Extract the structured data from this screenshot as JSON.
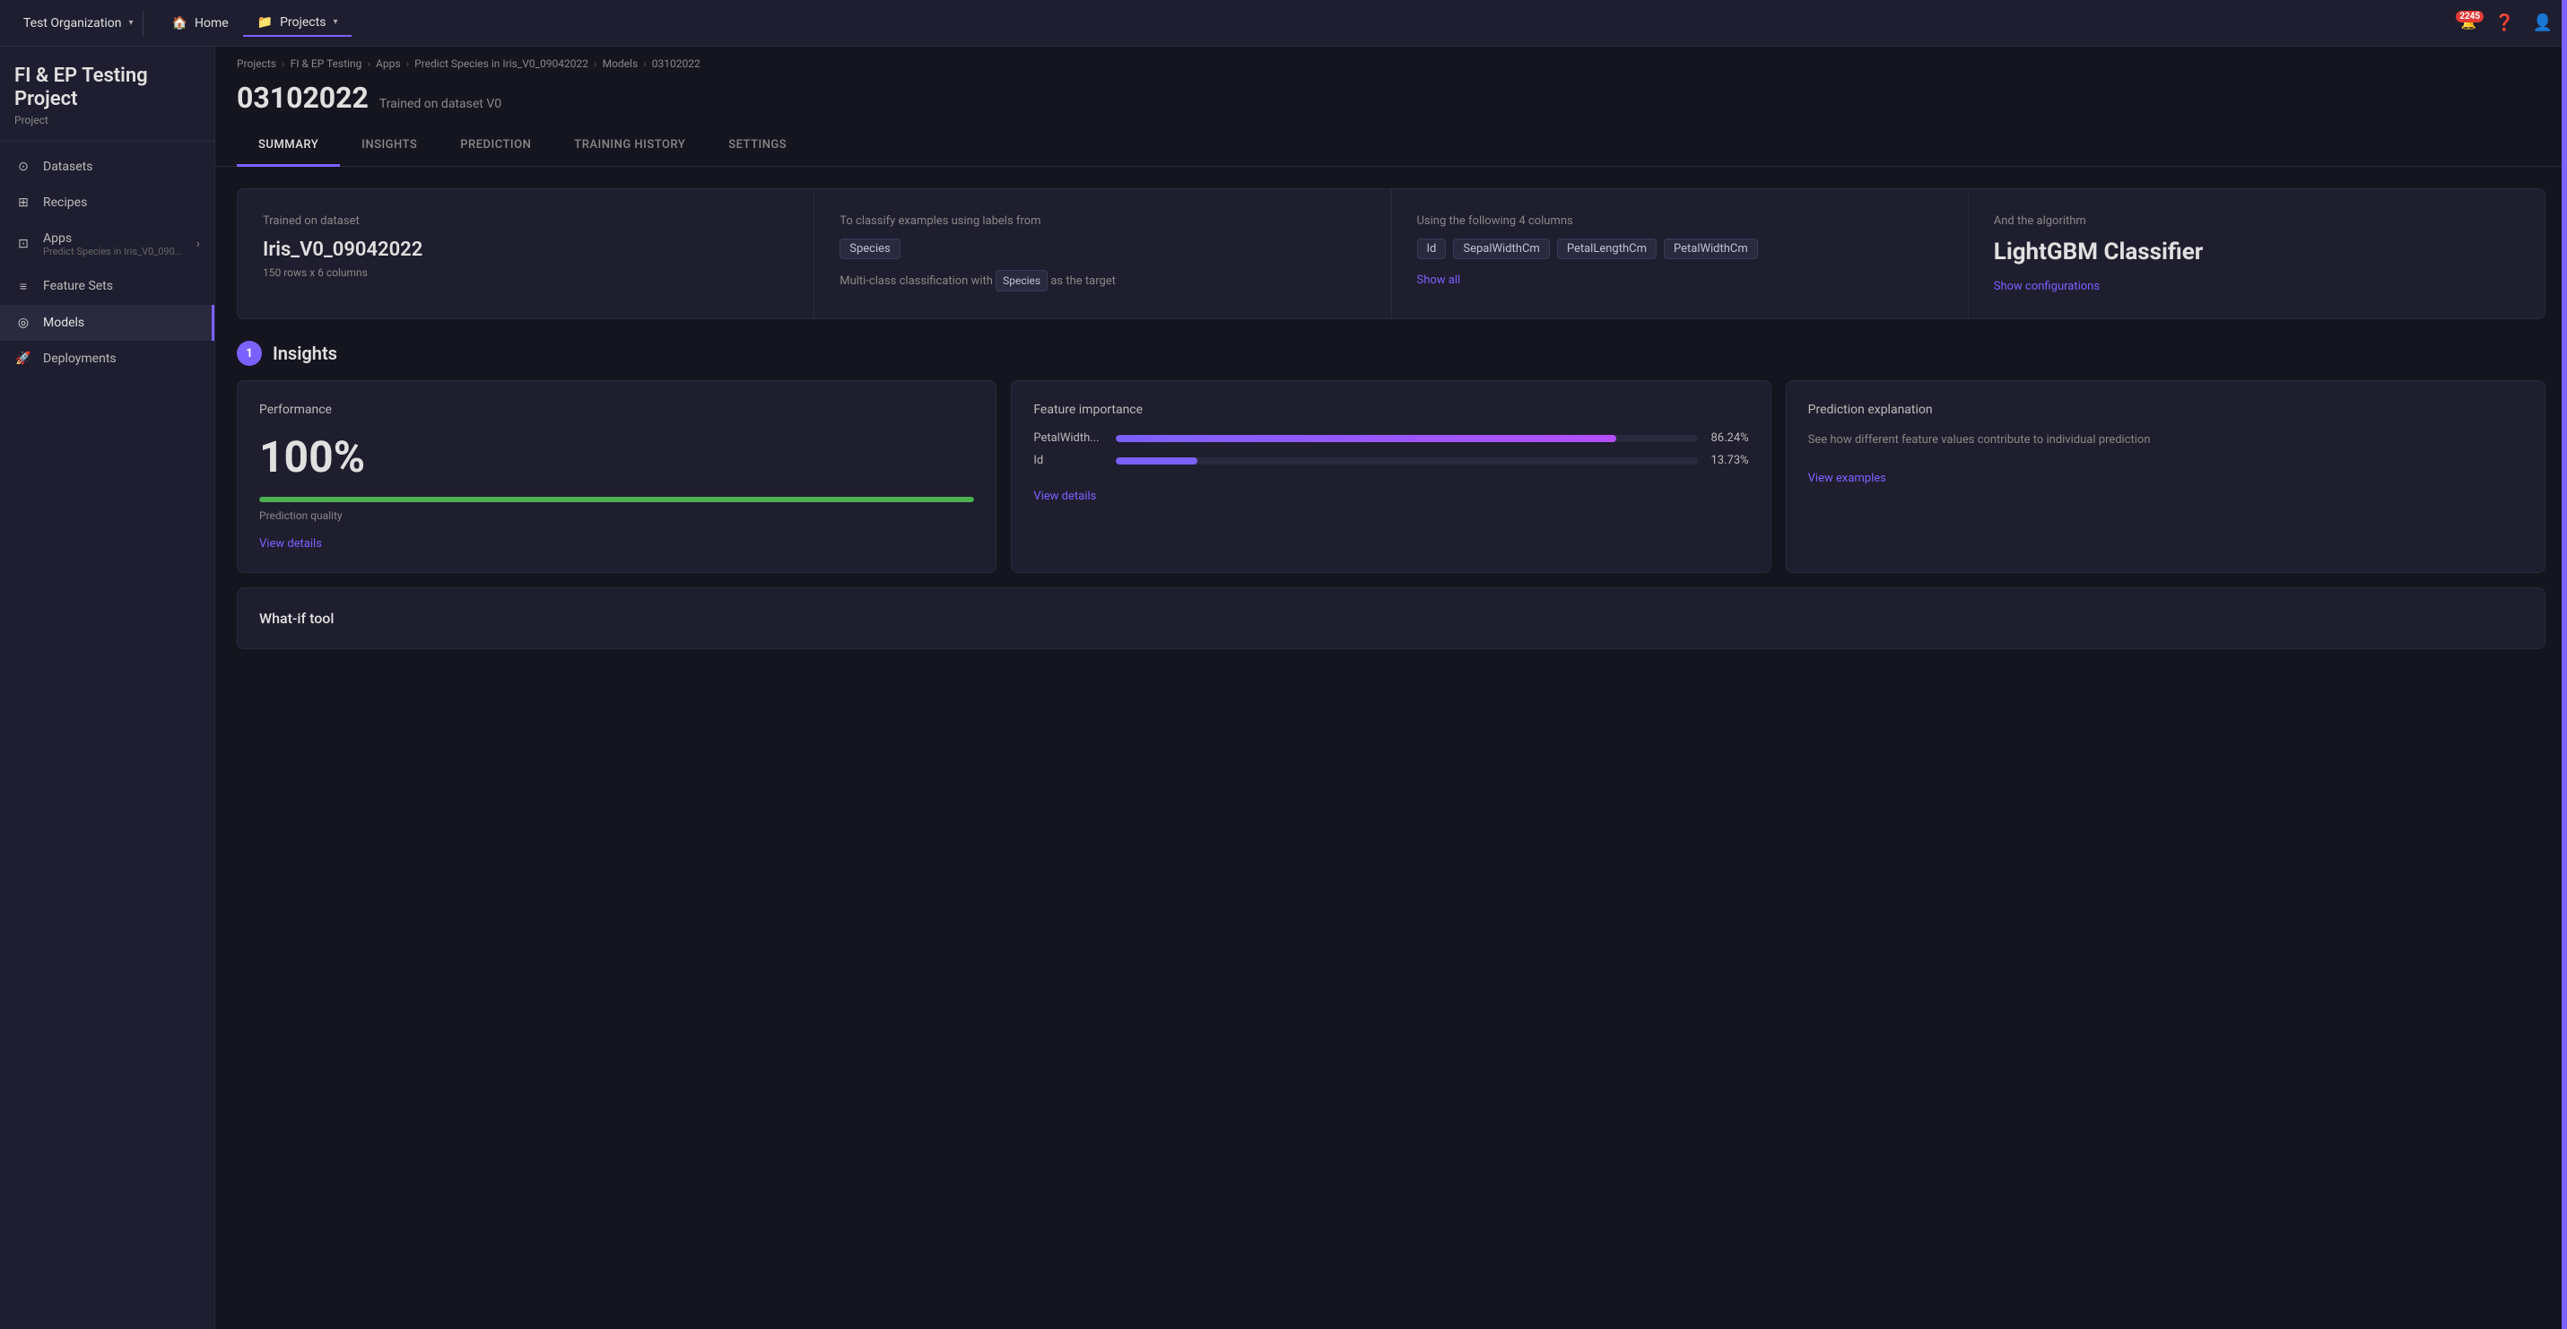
{
  "topNav": {
    "orgName": "Test Organization",
    "homeLabel": "Home",
    "projectsLabel": "Projects",
    "notificationCount": "2245",
    "helpIcon": "?",
    "userIcon": "👤"
  },
  "sidebar": {
    "projectName": "FI & EP Testing Project",
    "projectType": "Project",
    "items": [
      {
        "id": "datasets",
        "label": "Datasets",
        "icon": "⊙"
      },
      {
        "id": "recipes",
        "label": "Recipes",
        "icon": "⊞"
      },
      {
        "id": "apps",
        "label": "Apps",
        "subLabel": "Predict Species in Iris_V0_090...",
        "icon": "⊡",
        "hasArrow": true
      },
      {
        "id": "feature-sets",
        "label": "Feature Sets",
        "icon": "≡"
      },
      {
        "id": "models",
        "label": "Models",
        "icon": "◎",
        "active": true
      },
      {
        "id": "deployments",
        "label": "Deployments",
        "icon": "🚀"
      }
    ]
  },
  "breadcrumb": {
    "items": [
      "Projects",
      "FI & EP Testing",
      "Apps",
      "Predict Species in Iris_V0_09042022",
      "Models",
      "03102022"
    ]
  },
  "pageTitle": "03102022",
  "pageSubtitle": "Trained on dataset V0",
  "tabs": [
    {
      "id": "summary",
      "label": "SUMMARY",
      "active": true
    },
    {
      "id": "insights",
      "label": "INSIGHTS"
    },
    {
      "id": "prediction",
      "label": "PREDICTION"
    },
    {
      "id": "training-history",
      "label": "TRAINING HISTORY"
    },
    {
      "id": "settings",
      "label": "SETTINGS"
    }
  ],
  "summaryCards": [
    {
      "id": "trained-on",
      "label": "Trained on dataset",
      "value": "Iris_V0_09042022",
      "sub": "150 rows x 6 columns"
    },
    {
      "id": "classify",
      "label": "To classify examples using labels from",
      "tag": "Species",
      "description": "Multi-class classification with",
      "descriptionTag": "Species",
      "descriptionSuffix": "as the target"
    },
    {
      "id": "columns",
      "label": "Using the following 4 columns",
      "tags": [
        "Id",
        "SepalWidthCm",
        "PetalLengthCm",
        "PetalWidthCm"
      ],
      "showAllLabel": "Show all"
    },
    {
      "id": "algorithm",
      "label": "And the algorithm",
      "value": "LightGBM Classifier",
      "showConfigLabel": "Show configurations"
    }
  ],
  "insights": {
    "title": "Insights",
    "badgeNumber": "1",
    "cards": [
      {
        "id": "performance",
        "title": "Performance",
        "value": "100%",
        "progressPercent": 100,
        "qualityLabel": "Prediction quality",
        "viewDetailsLabel": "View details"
      },
      {
        "id": "feature-importance",
        "title": "Feature importance",
        "features": [
          {
            "label": "PetalWidth...",
            "percent": "86.24%",
            "barWidth": 86
          },
          {
            "label": "Id",
            "percent": "13.73%",
            "barWidth": 14
          }
        ],
        "viewDetailsLabel": "View details"
      },
      {
        "id": "prediction-explanation",
        "title": "Prediction explanation",
        "description": "See how different feature values contribute to individual prediction",
        "viewExamplesLabel": "View examples"
      }
    ]
  },
  "whatIfSection": {
    "title": "What-if tool"
  }
}
